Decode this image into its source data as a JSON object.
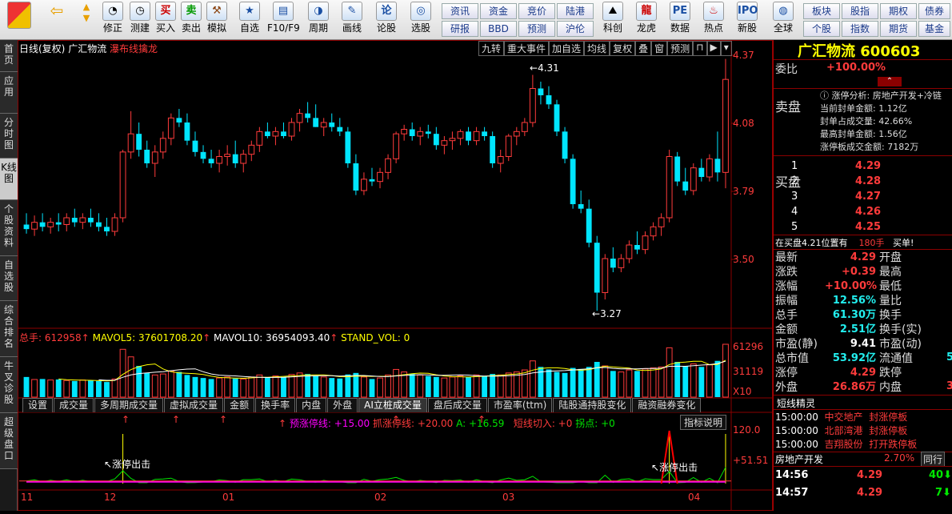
{
  "toolbar": {
    "items": [
      "修正",
      "测建",
      "买入",
      "卖出",
      "模拟",
      "自选",
      "F10/F9",
      "周期",
      "画线",
      "论股",
      "选股",
      "科创",
      "龙虎",
      "数据",
      "热点",
      "新股",
      "全球"
    ],
    "buttons": [
      "资讯",
      "资金",
      "竞价",
      "陆港",
      "研报",
      "BBD",
      "预测",
      "沪伦",
      "板块",
      "股指",
      "期权",
      "债券",
      "个股",
      "指数",
      "期货",
      "基金"
    ]
  },
  "sidebar": [
    "首页",
    "应用",
    "分时图",
    "K线图",
    "个股资料",
    "自选股",
    "综合排名",
    "牛叉诊股",
    "超级盘口"
  ],
  "chart": {
    "title_prefix": "日线(复权)",
    "stock_name": "广汇物流",
    "signal": "瀑布线擒龙",
    "top_menu": [
      "九转",
      "重大事件",
      "加自选",
      "均线",
      "复权",
      "叠",
      "窗",
      "预测"
    ],
    "price_axis": [
      "4.37",
      "4.08",
      "3.79",
      "3.50"
    ],
    "max_label": "4.31",
    "min_label": "3.27",
    "vol_legend": {
      "total": "总手: 612958",
      "mavol5": "MAVOL5: 37601708.20",
      "mavol10": "MAVOL10: 36954093.40",
      "stand": "STAND_VOL: 0"
    },
    "vol_axis": [
      "61296",
      "31119",
      "X10"
    ],
    "indicator_tabs": [
      "设置",
      "成交量",
      "多周期成交量",
      "虚拟成交量",
      "金额",
      "换手率",
      "内盘",
      "外盘",
      "AI立桩成交量",
      "盘后成交量",
      "市盈率(ttm)",
      "陆股通持股变化",
      "融资融券变化"
    ],
    "ind_legend": {
      "a": "预涨停线: +15.00",
      "b": "抓涨停线: +20.00",
      "c": "A: +16.59",
      "d": "短线切入: +0",
      "e": "拐点: +0"
    },
    "ind_help": "指标说明",
    "ind_axis": [
      "120.0",
      "+51.51"
    ],
    "ind_annot1": "涨停出击",
    "ind_annot2": "涨停出击",
    "x_axis": [
      "11",
      "12",
      "01",
      "02",
      "03",
      "04"
    ],
    "colors": {
      "up": "#ff3b3b",
      "down": "#00e5ff",
      "bg": "#000000",
      "border": "#8b0000"
    }
  },
  "chart_data": {
    "type": "candlestick",
    "title": "日线(复权) 广汇物流",
    "ylim": [
      3.2,
      4.4
    ],
    "ohlc": [
      [
        3.65,
        3.7,
        3.61,
        3.63
      ],
      [
        3.63,
        3.69,
        3.6,
        3.66
      ],
      [
        3.66,
        3.7,
        3.62,
        3.64
      ],
      [
        3.64,
        3.68,
        3.61,
        3.66
      ],
      [
        3.66,
        3.7,
        3.62,
        3.65
      ],
      [
        3.65,
        3.7,
        3.62,
        3.68
      ],
      [
        3.68,
        3.72,
        3.64,
        3.66
      ],
      [
        3.66,
        3.7,
        3.63,
        3.68
      ],
      [
        3.68,
        3.72,
        3.64,
        3.66
      ],
      [
        3.66,
        3.7,
        3.62,
        3.64
      ],
      [
        3.64,
        3.68,
        3.6,
        3.62
      ],
      [
        3.62,
        3.7,
        3.6,
        3.68
      ],
      [
        3.68,
        3.98,
        3.66,
        3.97
      ],
      [
        3.97,
        4.15,
        3.94,
        4.05
      ],
      [
        4.05,
        4.1,
        3.95,
        3.98
      ],
      [
        3.98,
        4.02,
        3.9,
        3.92
      ],
      [
        3.92,
        4.0,
        3.86,
        3.97
      ],
      [
        3.97,
        4.06,
        3.94,
        4.03
      ],
      [
        4.03,
        4.14,
        4.0,
        4.12
      ],
      [
        4.12,
        4.16,
        4.08,
        4.1
      ],
      [
        4.1,
        4.14,
        4.0,
        4.02
      ],
      [
        4.02,
        4.06,
        3.95,
        3.97
      ],
      [
        3.97,
        4.0,
        3.92,
        3.94
      ],
      [
        3.94,
        3.98,
        3.9,
        3.92
      ],
      [
        3.92,
        3.98,
        3.88,
        3.95
      ],
      [
        3.95,
        4.0,
        3.91,
        3.96
      ],
      [
        3.96,
        4.02,
        3.9,
        3.92
      ],
      [
        3.92,
        3.98,
        3.88,
        3.96
      ],
      [
        3.96,
        4.02,
        3.93,
        4.0
      ],
      [
        4.0,
        4.08,
        3.97,
        4.06
      ],
      [
        4.06,
        4.1,
        4.03,
        4.04
      ],
      [
        4.04,
        4.08,
        4.0,
        4.06
      ],
      [
        4.06,
        4.1,
        4.03,
        4.04
      ],
      [
        4.04,
        4.12,
        4.02,
        4.1
      ],
      [
        4.1,
        4.16,
        4.06,
        4.14
      ],
      [
        4.14,
        4.19,
        4.1,
        4.12
      ],
      [
        4.12,
        4.18,
        4.08,
        4.08
      ],
      [
        4.08,
        4.12,
        4.04,
        4.1
      ],
      [
        4.1,
        4.14,
        4.06,
        4.08
      ],
      [
        4.08,
        4.12,
        4.04,
        4.06
      ],
      [
        4.06,
        4.08,
        3.9,
        3.92
      ],
      [
        3.92,
        3.96,
        3.78,
        3.8
      ],
      [
        3.8,
        3.88,
        3.78,
        3.85
      ],
      [
        3.85,
        3.9,
        3.82,
        3.84
      ],
      [
        3.84,
        3.9,
        3.81,
        3.88
      ],
      [
        3.88,
        3.96,
        3.85,
        3.94
      ],
      [
        3.94,
        4.06,
        3.92,
        4.05
      ],
      [
        4.05,
        4.09,
        4.02,
        4.07
      ],
      [
        4.07,
        4.1,
        4.02,
        4.04
      ],
      [
        4.04,
        4.08,
        4.0,
        4.06
      ],
      [
        4.06,
        4.09,
        4.03,
        4.05
      ],
      [
        4.05,
        4.08,
        3.98,
        4.0
      ],
      [
        4.0,
        4.04,
        3.96,
        4.02
      ],
      [
        4.02,
        4.06,
        3.98,
        4.03
      ],
      [
        4.03,
        4.07,
        4.0,
        4.06
      ],
      [
        4.06,
        4.08,
        4.0,
        4.02
      ],
      [
        4.02,
        4.08,
        4.0,
        4.06
      ],
      [
        4.06,
        4.08,
        4.02,
        4.04
      ],
      [
        4.04,
        4.06,
        3.9,
        3.92
      ],
      [
        3.92,
        3.98,
        3.88,
        3.95
      ],
      [
        3.95,
        4.05,
        3.93,
        4.04
      ],
      [
        4.04,
        4.08,
        4.0,
        4.06
      ],
      [
        4.06,
        4.12,
        4.04,
        4.1
      ],
      [
        4.1,
        4.31,
        4.08,
        4.25
      ],
      [
        4.25,
        4.28,
        4.18,
        4.22
      ],
      [
        4.22,
        4.26,
        4.16,
        4.18
      ],
      [
        4.18,
        4.2,
        4.04,
        4.06
      ],
      [
        4.06,
        4.08,
        3.92,
        3.94
      ],
      [
        3.94,
        3.96,
        3.72,
        3.74
      ],
      [
        3.74,
        3.8,
        3.7,
        3.72
      ],
      [
        3.72,
        3.76,
        3.55,
        3.57
      ],
      [
        3.57,
        3.6,
        3.27,
        3.35
      ],
      [
        3.35,
        3.52,
        3.32,
        3.5
      ],
      [
        3.5,
        3.55,
        3.44,
        3.46
      ],
      [
        3.46,
        3.52,
        3.44,
        3.5
      ],
      [
        3.5,
        3.58,
        3.48,
        3.56
      ],
      [
        3.56,
        3.62,
        3.52,
        3.54
      ],
      [
        3.54,
        3.62,
        3.52,
        3.6
      ],
      [
        3.6,
        3.66,
        3.58,
        3.64
      ],
      [
        3.64,
        3.7,
        3.6,
        3.68
      ],
      [
        3.68,
        3.98,
        3.66,
        3.95
      ],
      [
        3.95,
        3.97,
        3.82,
        3.84
      ],
      [
        3.84,
        3.9,
        3.78,
        3.8
      ],
      [
        3.8,
        3.92,
        3.78,
        3.9
      ],
      [
        3.9,
        3.94,
        3.84,
        3.86
      ],
      [
        3.86,
        3.96,
        3.84,
        3.94
      ],
      [
        3.94,
        4.06,
        3.84,
        3.88
      ],
      [
        3.88,
        4.38,
        3.81,
        4.29
      ]
    ],
    "volume": [
      40,
      35,
      36,
      34,
      35,
      33,
      32,
      34,
      33,
      32,
      30,
      36,
      95,
      80,
      62,
      48,
      44,
      46,
      52,
      50,
      44,
      40,
      38,
      36,
      38,
      40,
      37,
      36,
      40,
      44,
      40,
      42,
      40,
      45,
      48,
      46,
      42,
      40,
      38,
      37,
      45,
      48,
      40,
      36,
      38,
      44,
      55,
      50,
      46,
      44,
      42,
      40,
      38,
      40,
      42,
      40,
      44,
      42,
      46,
      44,
      48,
      50,
      54,
      72,
      60,
      55,
      50,
      48,
      58,
      56,
      60,
      70,
      62,
      52,
      50,
      54,
      52,
      56,
      58,
      60,
      98,
      70,
      62,
      66,
      60,
      64,
      72,
      105
    ]
  },
  "right": {
    "stock_title": "广汇物流 600603",
    "weibi_label": "委比",
    "weibi_value": "+100.00%",
    "sell_label": "卖盘",
    "limit_info": {
      "line1": "涨停分析: 房地产开发+冷链",
      "line2": "当前封单金额: 1.12亿",
      "line3": "封单占成交量: 42.66%",
      "line4": "最高封单金额: 1.56亿",
      "line5": "涨停板成交金额: 7182万"
    },
    "buy_label": "买盘",
    "buy_levels": [
      {
        "n": "1",
        "p": "4.29"
      },
      {
        "n": "2",
        "p": "4.28"
      },
      {
        "n": "3",
        "p": "4.27"
      },
      {
        "n": "4",
        "p": "4.26"
      },
      {
        "n": "5",
        "p": "4.25"
      }
    ],
    "buy_note": "在买盘4.21位置有",
    "buy_note_qty": "180手",
    "buy_note_act": "买单!",
    "quotes": [
      {
        "l": "最新",
        "v": "4.29",
        "l2": "开盘",
        "c": "red"
      },
      {
        "l": "涨跌",
        "v": "+0.39",
        "l2": "最高",
        "c": "red"
      },
      {
        "l": "涨幅",
        "v": "+10.00%",
        "l2": "最低",
        "c": "red"
      },
      {
        "l": "振幅",
        "v": "12.56%",
        "l2": "量比",
        "c": "cyn"
      },
      {
        "l": "总手",
        "v": "61.30万",
        "l2": "换手",
        "c": "cyn"
      },
      {
        "l": "金额",
        "v": "2.51亿",
        "l2": "换手(实)",
        "c": "cyn"
      },
      {
        "l": "市盈(静)",
        "v": "9.41",
        "l2": "市盈(动)",
        "c": "wht"
      },
      {
        "l": "总市值",
        "v": "53.92亿",
        "l2": "流通值",
        "c": "cyn"
      },
      {
        "l": "涨停",
        "v": "4.29",
        "l2": "跌停",
        "c": "red"
      },
      {
        "l": "外盘",
        "v": "26.86万",
        "l2": "内盘",
        "c": "red"
      }
    ],
    "right_partial": [
      "5",
      "3"
    ],
    "short_title": "短线精灵",
    "short_rows": [
      {
        "t": "15:00:00",
        "n": "中交地产",
        "e": "封涨停板"
      },
      {
        "t": "15:00:00",
        "n": "北部湾港",
        "e": "封涨停板"
      },
      {
        "t": "15:00:00",
        "n": "吉翔股份",
        "e": "打开跌停板"
      }
    ],
    "sector_name": "房地产开发",
    "sector_pct": "2.70%",
    "sector_tab": "同行",
    "ticks": [
      {
        "t": "14:56",
        "p": "4.29",
        "v": "40"
      },
      {
        "t": "14:57",
        "p": "4.29",
        "v": "7"
      }
    ]
  }
}
